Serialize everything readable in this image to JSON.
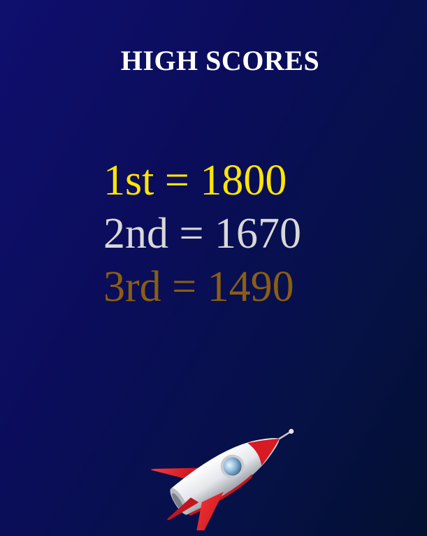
{
  "screen": {
    "title": "HIGH SCORES"
  },
  "scores": [
    {
      "text": "1st = 1800",
      "color": "#ffe600"
    },
    {
      "text": "2nd = 1670",
      "color": "#d8d8d8"
    },
    {
      "text": "3rd = 1490",
      "color": "#8a5e12"
    }
  ],
  "decor": {
    "rocket_icon": "rocket-icon"
  }
}
